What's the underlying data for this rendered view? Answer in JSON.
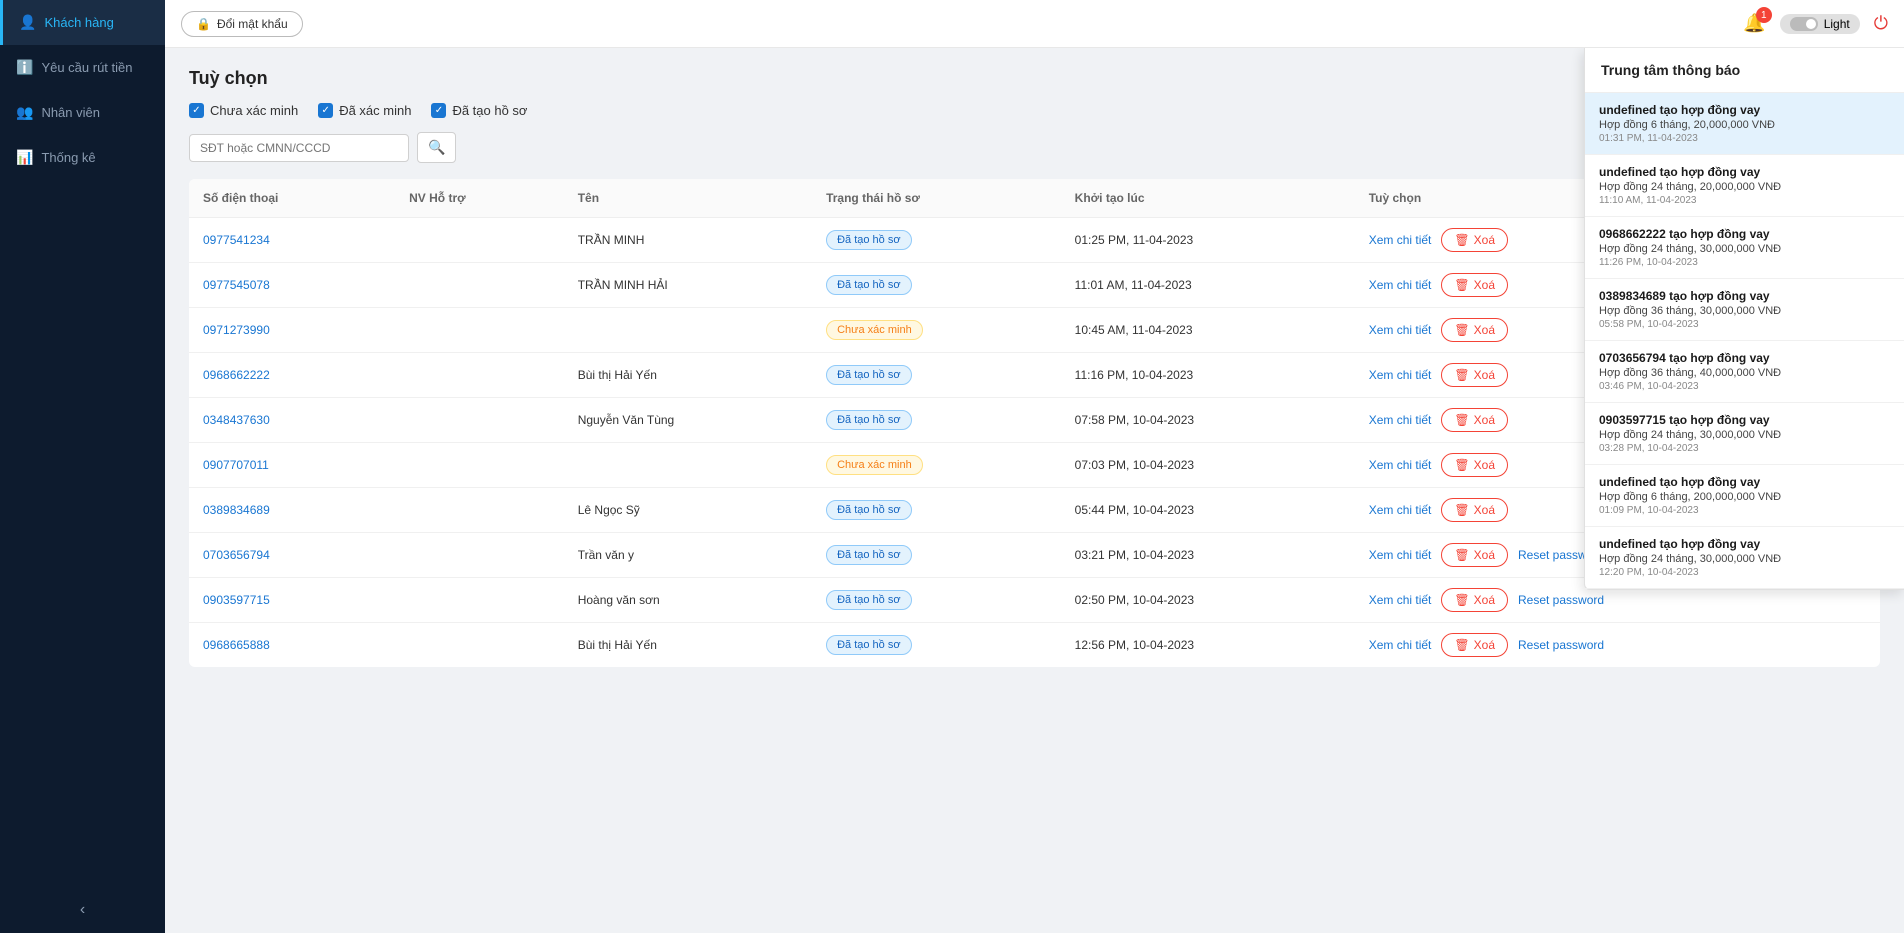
{
  "sidebar": {
    "items": [
      {
        "id": "khach-hang",
        "label": "Khách hàng",
        "icon": "👤",
        "active": true
      },
      {
        "id": "yeu-cau-rut-tien",
        "label": "Yêu cầu rút tiền",
        "icon": "ℹ️",
        "active": false
      },
      {
        "id": "nhan-vien",
        "label": "Nhân viên",
        "icon": "👥",
        "active": false
      },
      {
        "id": "thong-ke",
        "label": "Thống kê",
        "icon": "📊",
        "active": false
      }
    ],
    "collapse_icon": "‹"
  },
  "topbar": {
    "change_password_label": "Đổi mật khẩu",
    "notification_count": "1",
    "theme_label": "Light",
    "power_icon": "⏻"
  },
  "page": {
    "title": "Tuỳ chọn",
    "filters": [
      {
        "id": "chua-xac-minh",
        "label": "Chưa xác minh",
        "checked": true
      },
      {
        "id": "da-xac-minh",
        "label": "Đã xác minh",
        "checked": true
      },
      {
        "id": "da-tao-ho-so",
        "label": "Đã tạo hồ sơ",
        "checked": true
      }
    ],
    "search_placeholder": "SĐT hoặc CMNN/CCCD",
    "table": {
      "columns": [
        "Số điện thoại",
        "NV Hỗ trợ",
        "Tên",
        "Trạng thái hồ sơ",
        "Khởi tạo lúc",
        "Tuỳ chọn"
      ],
      "rows": [
        {
          "phone": "0977541234",
          "nv": "",
          "name": "TRẦN MINH",
          "status": "Đã tạo hồ sơ",
          "status_type": "created",
          "time": "01:25 PM, 11-04-2023"
        },
        {
          "phone": "0977545078",
          "nv": "",
          "name": "TRẦN MINH HẢI",
          "status": "Đã tạo hồ sơ",
          "status_type": "created",
          "time": "11:01 AM, 11-04-2023"
        },
        {
          "phone": "0971273990",
          "nv": "",
          "name": "",
          "status": "Chưa xác minh",
          "status_type": "pending",
          "time": "10:45 AM, 11-04-2023"
        },
        {
          "phone": "0968662222",
          "nv": "",
          "name": "Bùi thị Hải Yến",
          "status": "Đã tạo hồ sơ",
          "status_type": "created",
          "time": "11:16 PM, 10-04-2023"
        },
        {
          "phone": "0348437630",
          "nv": "",
          "name": "Nguyễn Văn Tùng",
          "status": "Đã tạo hồ sơ",
          "status_type": "created",
          "time": "07:58 PM, 10-04-2023"
        },
        {
          "phone": "0907707011",
          "nv": "",
          "name": "",
          "status": "Chưa xác minh",
          "status_type": "pending",
          "time": "07:03 PM, 10-04-2023"
        },
        {
          "phone": "0389834689",
          "nv": "",
          "name": "Lê Ngọc Sỹ",
          "status": "Đã tạo hồ sơ",
          "status_type": "created",
          "time": "05:44 PM, 10-04-2023"
        },
        {
          "phone": "0703656794",
          "nv": "",
          "name": "Trần văn y",
          "status": "Đã tạo hồ sơ",
          "status_type": "created",
          "time": "03:21 PM, 10-04-2023"
        },
        {
          "phone": "0903597715",
          "nv": "",
          "name": "Hoàng văn sơn",
          "status": "Đã tạo hồ sơ",
          "status_type": "created",
          "time": "02:50 PM, 10-04-2023"
        },
        {
          "phone": "0968665888",
          "nv": "",
          "name": "Bùi thị Hải Yến",
          "status": "Đã tạo hồ sơ",
          "status_type": "created",
          "time": "12:56 PM, 10-04-2023"
        }
      ],
      "view_label": "Xem chi tiết",
      "delete_label": "Xoá",
      "reset_label": "Reset password"
    }
  },
  "notifications": {
    "title": "Trung tâm thông báo",
    "items": [
      {
        "title": "undefined tạo hợp đồng vay",
        "desc": "Hợp đồng 6 tháng, 20,000,000 VNĐ",
        "time": "01:31 PM, 11-04-2023",
        "active": true
      },
      {
        "title": "undefined tạo hợp đồng vay",
        "desc": "Hợp đồng 24 tháng, 20,000,000 VNĐ",
        "time": "11:10 AM, 11-04-2023",
        "active": false
      },
      {
        "title": "0968662222 tạo hợp đồng vay",
        "desc": "Hợp đồng 24 tháng, 30,000,000 VNĐ",
        "time": "11:26 PM, 10-04-2023",
        "active": false
      },
      {
        "title": "0389834689 tạo hợp đồng vay",
        "desc": "Hợp đồng 36 tháng, 30,000,000 VNĐ",
        "time": "05:58 PM, 10-04-2023",
        "active": false
      },
      {
        "title": "0703656794 tạo hợp đồng vay",
        "desc": "Hợp đồng 36 tháng, 40,000,000 VNĐ",
        "time": "03:46 PM, 10-04-2023",
        "active": false
      },
      {
        "title": "0903597715 tạo hợp đồng vay",
        "desc": "Hợp đồng 24 tháng, 30,000,000 VNĐ",
        "time": "03:28 PM, 10-04-2023",
        "active": false
      },
      {
        "title": "undefined tạo hợp đồng vay",
        "desc": "Hợp đồng 6 tháng, 200,000,000 VNĐ",
        "time": "01:09 PM, 10-04-2023",
        "active": false
      },
      {
        "title": "undefined tạo hợp đồng vay",
        "desc": "Hợp đồng 24 tháng, 30,000,000 VNĐ",
        "time": "12:20 PM, 10-04-2023",
        "active": false
      }
    ]
  }
}
